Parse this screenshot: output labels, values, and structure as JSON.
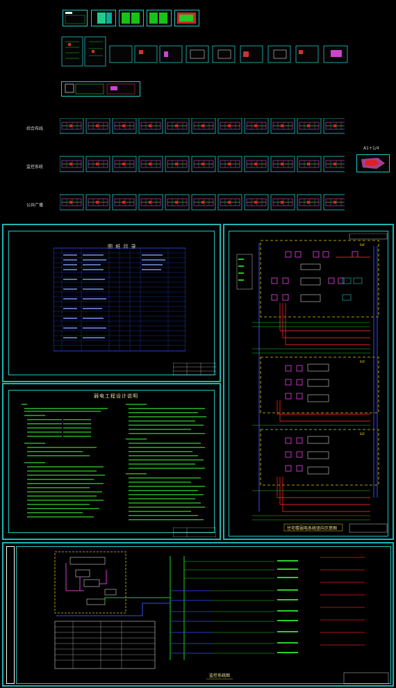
{
  "overview": {
    "rows": [
      {
        "label": "综合布线"
      },
      {
        "label": "监控系统"
      },
      {
        "label": "公共广播"
      }
    ],
    "scale_note": "A1+1/4"
  },
  "drawings": {
    "index_title": "图 纸 目 录",
    "design_notes_title": "弱电工程设计说明",
    "system_diagram_title": "监控系统图",
    "riser_title": "住宅楼弱电系统竖向示意图",
    "blocks": [
      "B4F",
      "B3F",
      "B2F"
    ]
  },
  "colors": {
    "frame": "#22c6c6",
    "accent_yellow": "#e6d000",
    "accent_red": "#e02020",
    "accent_magenta": "#d040d0",
    "accent_green": "#20d020",
    "accent_blue": "#3050ff"
  }
}
